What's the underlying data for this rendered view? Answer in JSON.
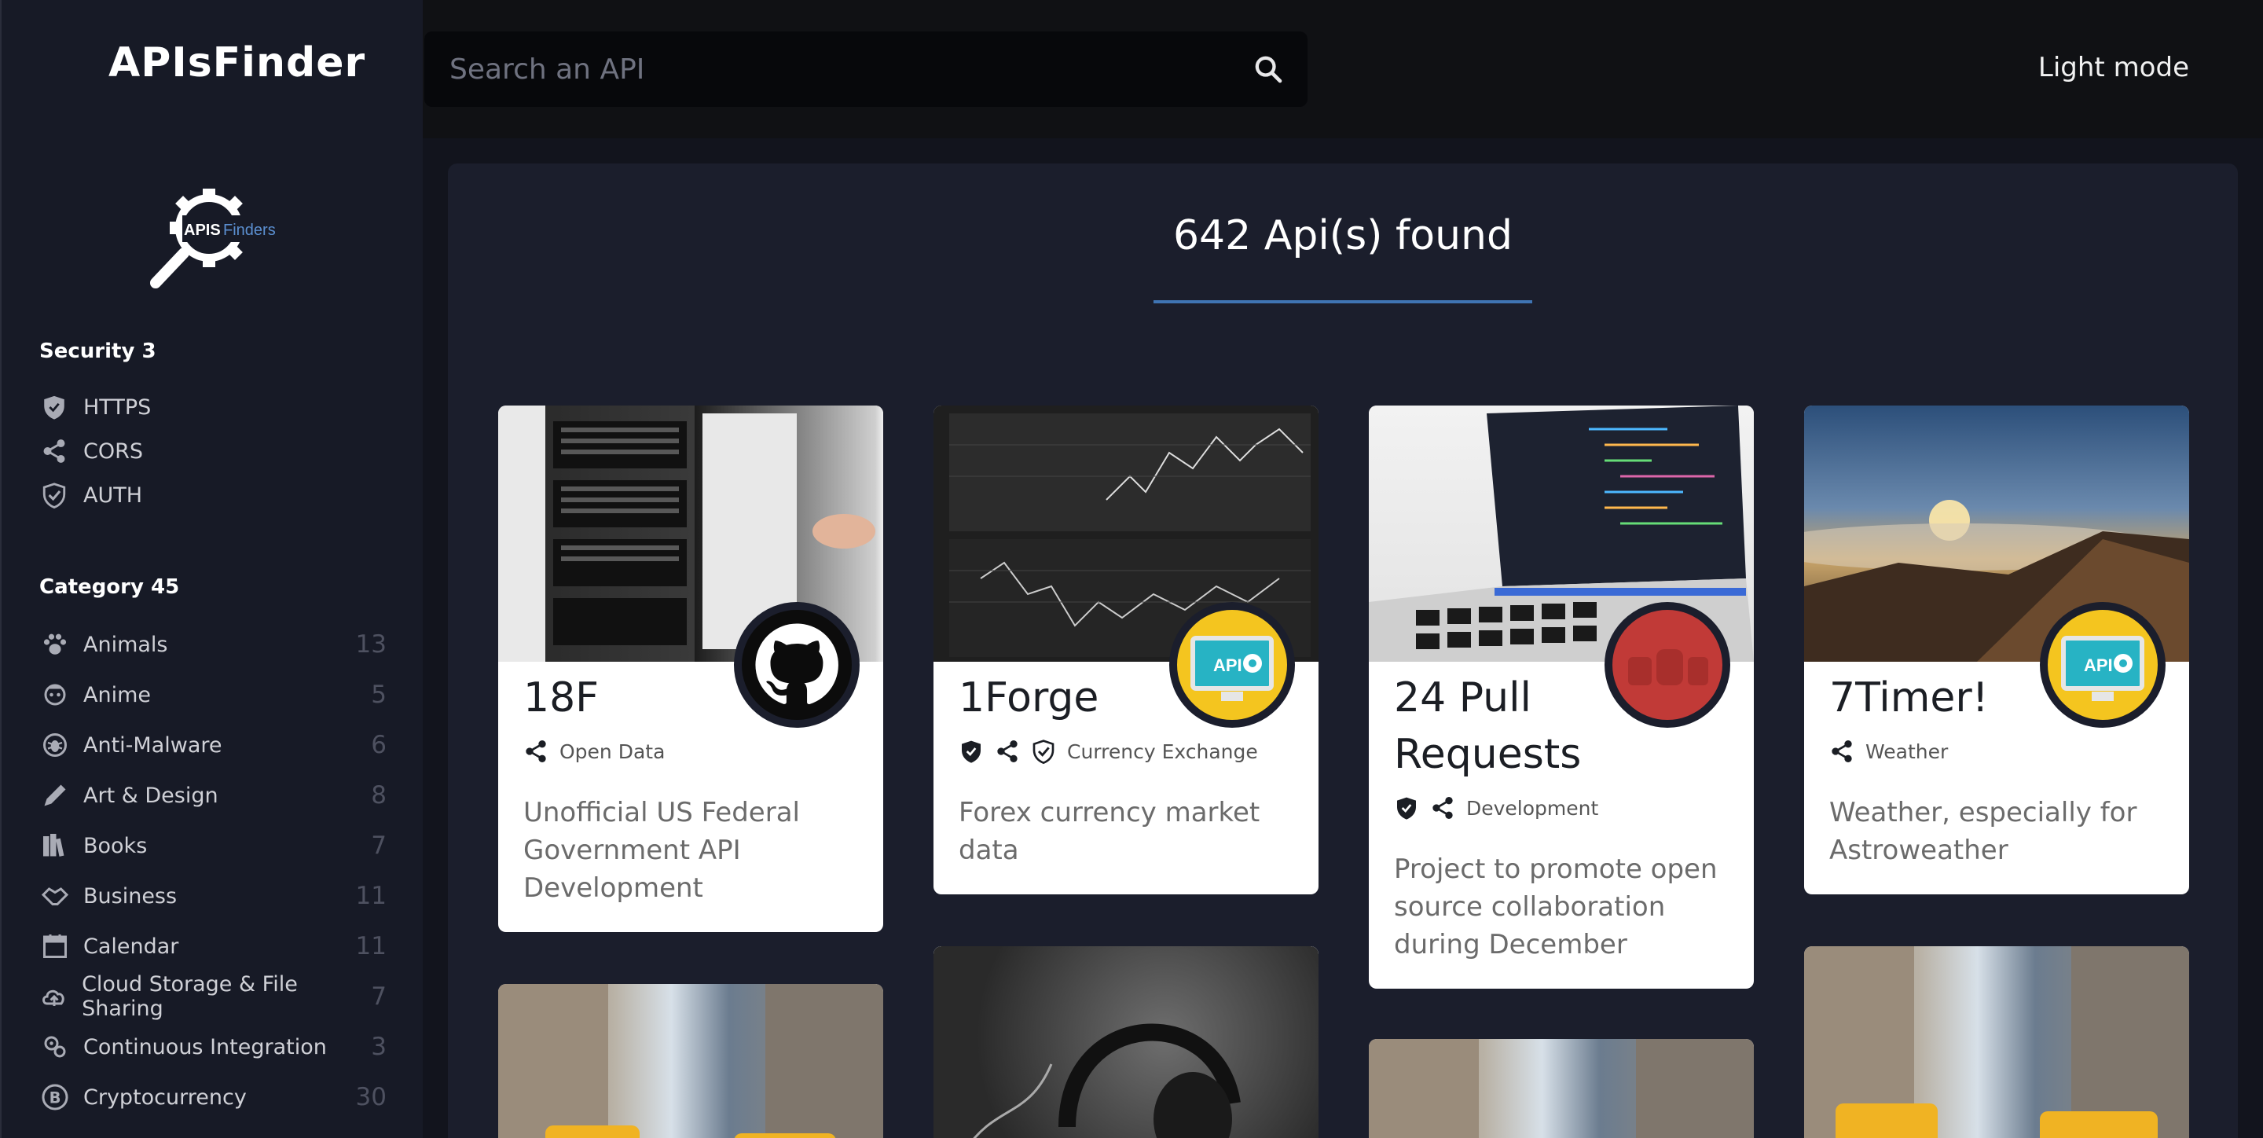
{
  "header": {
    "brand": "APIsFinder",
    "search_placeholder": "Search an API",
    "mode_toggle": "Light mode"
  },
  "sidebar": {
    "logo_text_a": "APIS",
    "logo_text_b": "Finders",
    "security_title": "Security 3",
    "security": [
      {
        "label": "HTTPS",
        "icon": "shield-icon"
      },
      {
        "label": "CORS",
        "icon": "share-icon"
      },
      {
        "label": "AUTH",
        "icon": "auth-check-icon"
      }
    ],
    "category_title": "Category 45",
    "categories": [
      {
        "label": "Animals",
        "count": "13",
        "icon": "paw-icon"
      },
      {
        "label": "Anime",
        "count": "5",
        "icon": "anime-icon"
      },
      {
        "label": "Anti-Malware",
        "count": "6",
        "icon": "bug-icon"
      },
      {
        "label": "Art & Design",
        "count": "8",
        "icon": "pen-icon"
      },
      {
        "label": "Books",
        "count": "7",
        "icon": "books-icon"
      },
      {
        "label": "Business",
        "count": "11",
        "icon": "handshake-icon"
      },
      {
        "label": "Calendar",
        "count": "11",
        "icon": "calendar-icon"
      },
      {
        "label": "Cloud Storage & File Sharing",
        "count": "7",
        "icon": "cloud-upload-icon"
      },
      {
        "label": "Continuous Integration",
        "count": "3",
        "icon": "gears-icon"
      },
      {
        "label": "Cryptocurrency",
        "count": "30",
        "icon": "bitcoin-icon"
      }
    ]
  },
  "main": {
    "found_text": "642 Api(s) found",
    "cards": [
      {
        "name": "18F",
        "category": "Open Data",
        "description": "Unofficial US Federal Government API Development",
        "badges": [
          "share-icon"
        ],
        "avatar": "github-icon",
        "image": "server-rack"
      },
      {
        "name": "1Forge",
        "category": "Currency Exchange",
        "description": "Forex currency market data",
        "badges": [
          "shield-icon",
          "share-icon",
          "auth-check-icon"
        ],
        "avatar": "api-monitor-icon",
        "image": "stock-chart"
      },
      {
        "name": "24 Pull Requests",
        "category": "Development",
        "description": "Project to promote open source collaboration during December",
        "badges": [
          "shield-icon",
          "share-icon"
        ],
        "avatar": "24-logo-icon",
        "image": "laptop-code"
      },
      {
        "name": "7Timer!",
        "category": "Weather",
        "description": "Weather, especially for Astroweather",
        "badges": [
          "share-icon"
        ],
        "avatar": "api-monitor-icon",
        "image": "sunset-mountain"
      }
    ]
  },
  "colors": {
    "accent": "#3f74b3",
    "sidebar_bg": "#171a26",
    "content_bg": "#1b1e2c"
  }
}
